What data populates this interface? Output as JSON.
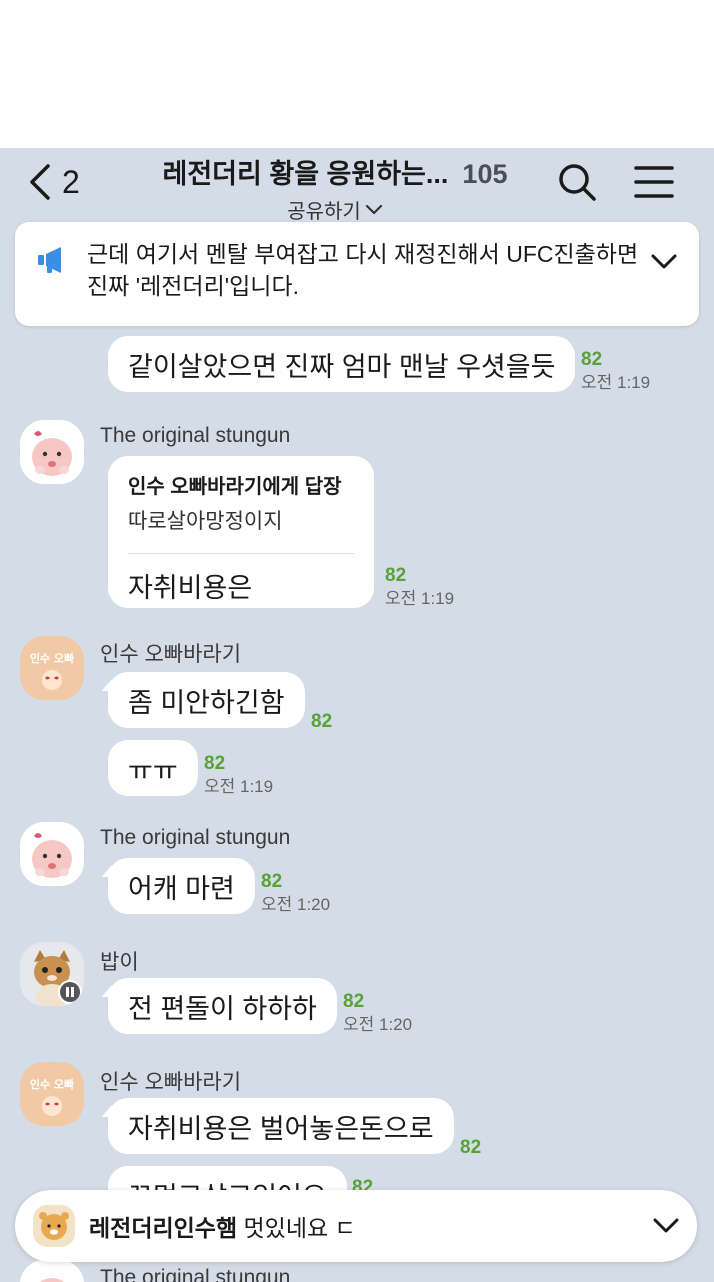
{
  "colors": {
    "chat_bg": "#d4dce7",
    "unread": "#58a236",
    "bubble": "#ffffff"
  },
  "header": {
    "back_count": "2",
    "title": "레전더리 황을 응원하는...",
    "member_count": "105",
    "share_label": "공유하기"
  },
  "notice": {
    "text": "근데 여기서 멘탈 부여잡고 다시 재정진해서 UFC진출하면 진짜 '레전더리'입니다."
  },
  "messages": [
    {
      "text": "같이살았으면 진짜 엄마 맨날 우셧을듯",
      "unread": "82",
      "time": "오전 1:19"
    },
    {
      "sender": "The original stungun",
      "reply_to": "인수 오빠바라기에게 답장",
      "reply_quote": "따로살아망정이지",
      "text": "자취비용은",
      "unread": "82",
      "time": "오전 1:19"
    },
    {
      "sender": "인수 오빠바라기",
      "text": "좀 미안하긴함",
      "unread": "82"
    },
    {
      "text": "ㅠㅠ",
      "unread": "82",
      "time": "오전 1:19"
    },
    {
      "sender": "The original stungun",
      "text": "어캐 마련",
      "unread": "82",
      "time": "오전 1:20"
    },
    {
      "sender": "밥이",
      "text": "전 편돌이 하하하",
      "unread": "82",
      "time": "오전 1:20"
    },
    {
      "sender": "인수 오빠바라기",
      "text": "자취비용은 벌어놓은돈으로",
      "unread": "82"
    },
    {
      "text": "꼬먹고살고있어요",
      "unread": "82"
    }
  ],
  "avatars": {
    "peach_icon": "peach-avatar-icon",
    "inssu_label": "인수 오빠",
    "cat_icon": "cat-avatar-icon"
  },
  "bottom_bar": {
    "name": "레전더리인수햄",
    "text": "멋있네요 ㄷ"
  },
  "peek_sender": "The original stungun"
}
